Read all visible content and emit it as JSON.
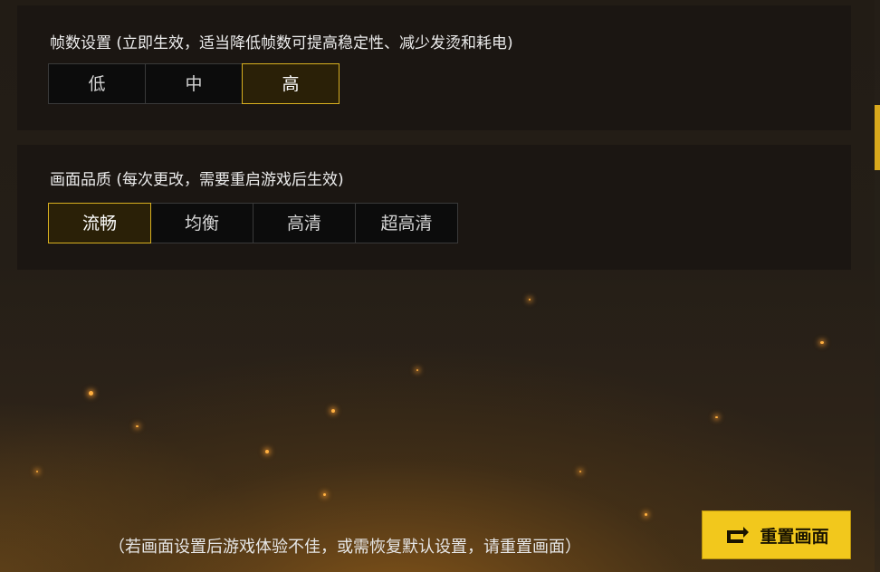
{
  "frame_rate": {
    "title": "帧数设置 (立即生效，适当降低帧数可提高稳定性、减少发烫和耗电)",
    "options": [
      "低",
      "中",
      "高"
    ],
    "selected": "高"
  },
  "graphics_quality": {
    "title": "画面品质 (每次更改，需要重启游戏后生效)",
    "options": [
      "流畅",
      "均衡",
      "高清",
      "超高清"
    ],
    "selected": "流畅"
  },
  "footer": {
    "note": "（若画面设置后游戏体验不佳，或需恢复默认设置，请重置画面）",
    "reset_label": "重置画面"
  },
  "colors": {
    "accent": "#f2c81c",
    "selected_border": "#d8b020"
  },
  "icons": {
    "reset": "reset-arrow-icon"
  }
}
